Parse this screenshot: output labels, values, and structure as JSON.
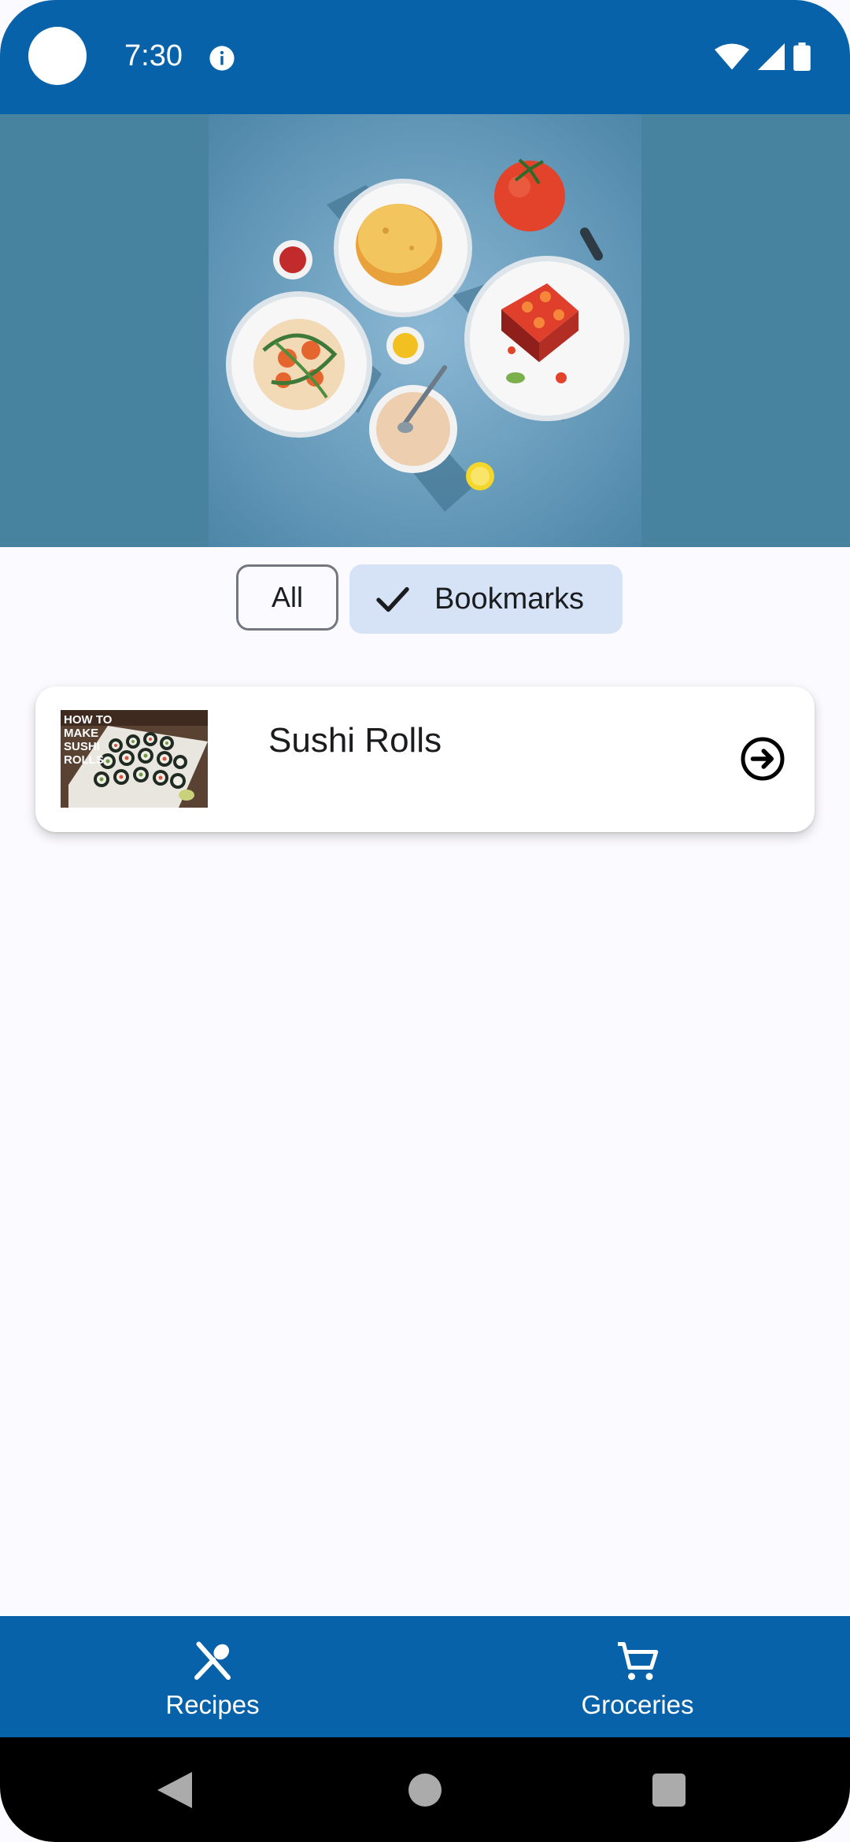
{
  "status_bar": {
    "time": "7:30",
    "icons": [
      "info-icon",
      "wifi-icon",
      "cellular-signal-icon",
      "battery-icon"
    ]
  },
  "hero": {
    "image": "food-illustration"
  },
  "filter_chips": [
    {
      "label": "All",
      "selected": false
    },
    {
      "label": "Bookmarks",
      "selected": true,
      "icon": "check-icon"
    }
  ],
  "recipes": [
    {
      "title": "Sushi Rolls",
      "thumbnail_text": "HOW TO MAKE SUSHI ROLLS",
      "action_icon": "arrow-circle-right-icon"
    }
  ],
  "bottom_nav": {
    "items": [
      {
        "label": "Recipes",
        "icon": "restaurant-icon"
      },
      {
        "label": "Groceries",
        "icon": "shopping-cart-icon"
      }
    ]
  },
  "system_nav": {
    "icons": [
      "back-icon",
      "home-icon",
      "recents-icon"
    ]
  },
  "colors": {
    "primary": "#0862A9",
    "hero_background": "#47829F",
    "chip_selected": "#D6E3F7",
    "surface": "#FBFAFE"
  }
}
